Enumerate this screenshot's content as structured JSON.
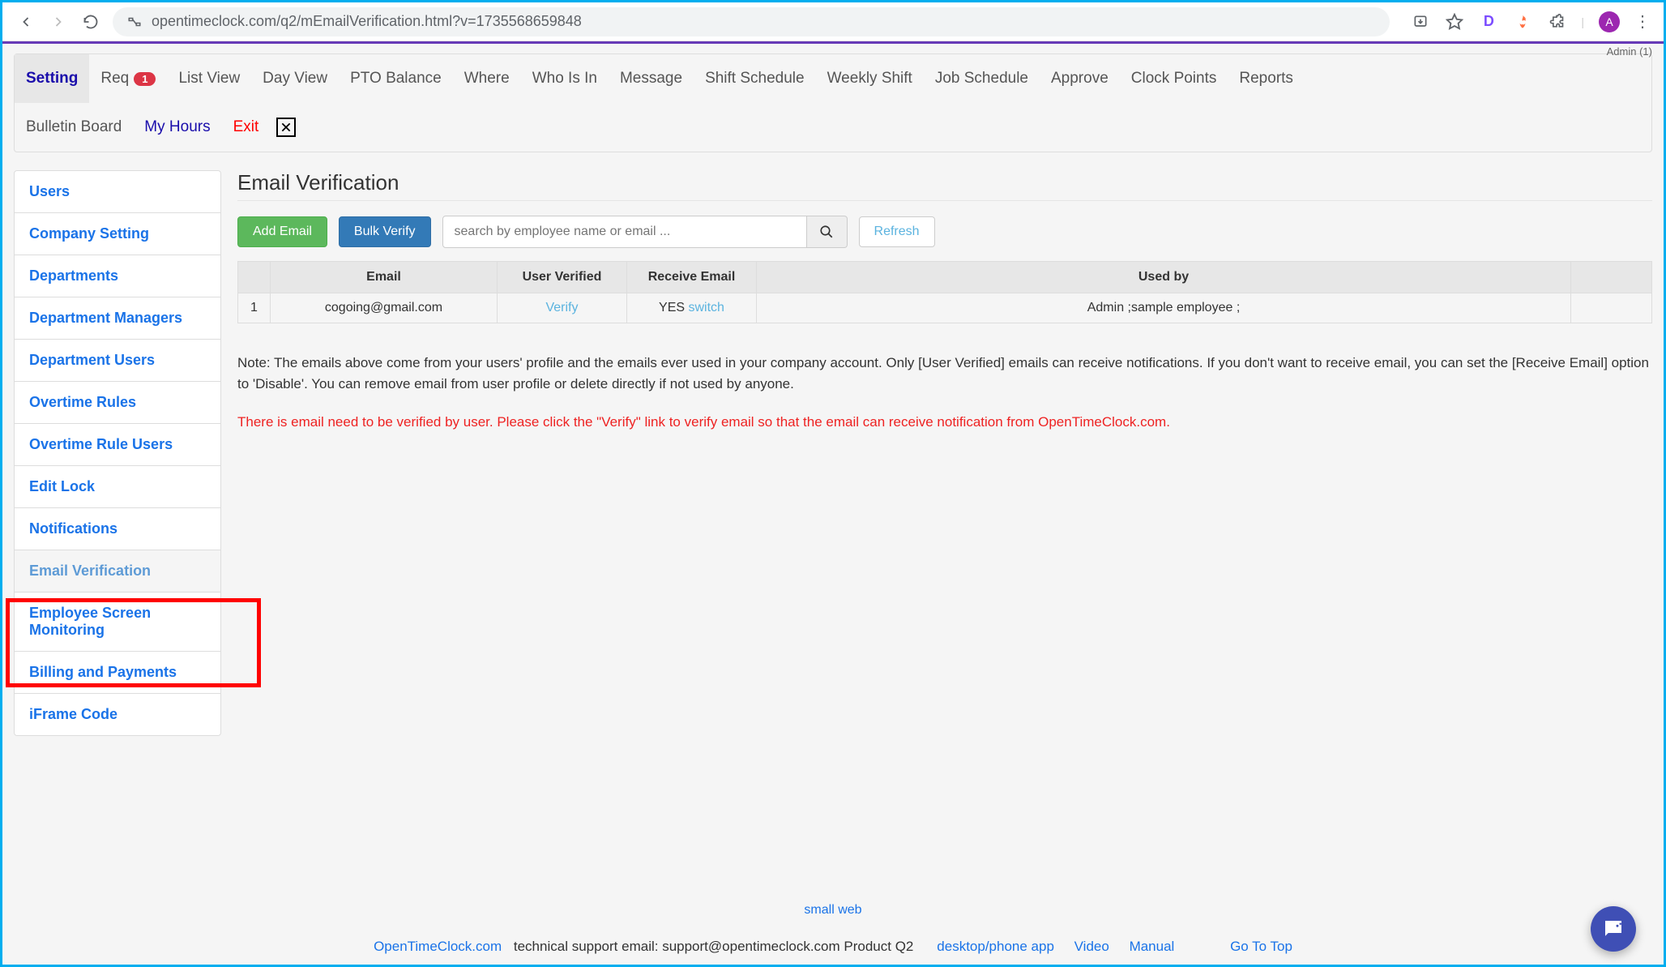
{
  "browser": {
    "url": "opentimeclock.com/q2/mEmailVerification.html?v=1735568659848",
    "avatar_letter": "A"
  },
  "admin_label": "Admin (1)",
  "topnav": {
    "row1": [
      {
        "label": "Setting",
        "active": true
      },
      {
        "label": "Req",
        "badge": "1"
      },
      {
        "label": "List View"
      },
      {
        "label": "Day View"
      },
      {
        "label": "PTO Balance"
      },
      {
        "label": "Where"
      },
      {
        "label": "Who Is In"
      },
      {
        "label": "Message"
      },
      {
        "label": "Shift Schedule"
      },
      {
        "label": "Weekly Shift"
      },
      {
        "label": "Job Schedule"
      },
      {
        "label": "Approve"
      },
      {
        "label": "Clock Points"
      },
      {
        "label": "Reports"
      }
    ],
    "row2": [
      {
        "label": "Bulletin Board"
      },
      {
        "label": "My Hours",
        "link": true
      },
      {
        "label": "Exit",
        "exit": true
      }
    ]
  },
  "sidebar": {
    "items": [
      {
        "label": "Users"
      },
      {
        "label": "Company Setting"
      },
      {
        "label": "Departments"
      },
      {
        "label": "Department Managers"
      },
      {
        "label": "Department Users"
      },
      {
        "label": "Overtime Rules"
      },
      {
        "label": "Overtime Rule Users"
      },
      {
        "label": "Edit Lock"
      },
      {
        "label": "Notifications"
      },
      {
        "label": "Email Verification",
        "active": true
      },
      {
        "label": "Employee Screen Monitoring"
      },
      {
        "label": "Billing and Payments"
      },
      {
        "label": "iFrame Code"
      }
    ]
  },
  "main": {
    "title": "Email Verification",
    "btn_add": "Add Email",
    "btn_bulk": "Bulk Verify",
    "search_placeholder": "search by employee name or email ...",
    "btn_refresh": "Refresh",
    "table": {
      "headers": [
        "",
        "Email",
        "User Verified",
        "Receive Email",
        "Used by",
        ""
      ],
      "rows": [
        {
          "n": "1",
          "email": "cogoing@gmail.com",
          "verified": "Verify",
          "receive_prefix": "YES ",
          "receive_link": "switch",
          "usedby": "Admin ;sample employee ;",
          "trailing": ""
        }
      ]
    },
    "note": "Note: The emails above come from your users' profile and the emails ever used in your company account. Only [User Verified] emails can receive notifications. If you don't want to receive email, you can set the [Receive Email] option to 'Disable'. You can remove email from user profile or delete directly if not used by anyone.",
    "warning": "There is email need to be verified by user. Please click the \"Verify\" link to verify email so that the email can receive notification from OpenTimeClock.com."
  },
  "footer": {
    "smallweb": "small web",
    "brand": "OpenTimeClock.com",
    "support_text": " technical support email: support@opentimeclock.com Product Q2",
    "link_app": "desktop/phone app",
    "link_video": "Video",
    "link_manual": "Manual",
    "gototop": "Go To Top"
  }
}
